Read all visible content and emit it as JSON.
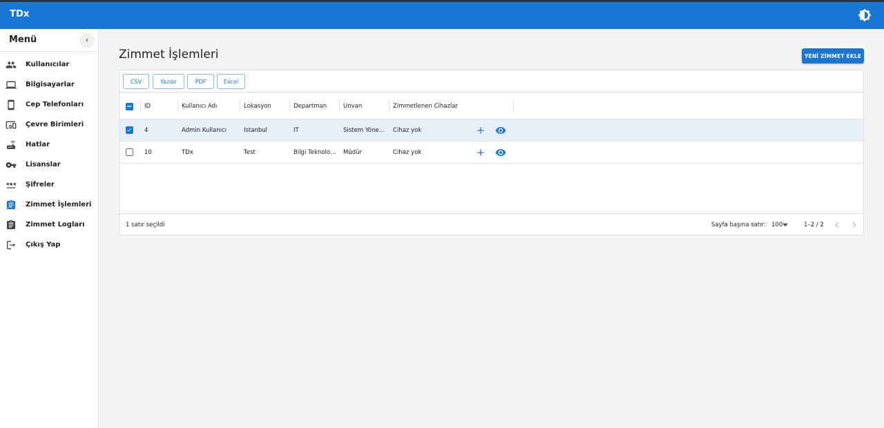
{
  "app": {
    "title": "TDx"
  },
  "sidebar": {
    "title": "Menü",
    "items": [
      {
        "label": "Kullanıcılar",
        "icon": "people-icon"
      },
      {
        "label": "Bilgisayarlar",
        "icon": "laptop-icon"
      },
      {
        "label": "Cep Telefonları",
        "icon": "smartphone-icon"
      },
      {
        "label": "Çevre Birimleri",
        "icon": "devices-icon"
      },
      {
        "label": "Hatlar",
        "icon": "router-icon"
      },
      {
        "label": "Lisanslar",
        "icon": "key-icon"
      },
      {
        "label": "Şifreler",
        "icon": "password-icon"
      },
      {
        "label": "Zimmet İşlemleri",
        "icon": "assignment-icon",
        "active": true
      },
      {
        "label": "Zimmet Logları",
        "icon": "clipboard-icon"
      },
      {
        "label": "Çıkış Yap",
        "icon": "logout-icon"
      }
    ]
  },
  "main": {
    "title": "Zimmet İşlemleri",
    "new_button": "YENİ ZİMMET EKLE",
    "export_buttons": [
      "CSV",
      "Yazdır",
      "PDF",
      "Excel"
    ]
  },
  "table": {
    "columns": [
      "ID",
      "Kullanıcı Adı",
      "Lokasyon",
      "Departman",
      "Unvan",
      "Zimmetlenen Cihazlar"
    ],
    "rows": [
      {
        "id": "4",
        "kullanici": "Admin Kullanıcı",
        "lokasyon": "İstanbul",
        "departman": "IT",
        "unvan": "Sistem Yöneticisi",
        "cihazlar": "Cihaz yok",
        "selected": true
      },
      {
        "id": "10",
        "kullanici": "TDx",
        "lokasyon": "Test",
        "departman": "Bilgi Teknolojileri",
        "unvan": "Müdür",
        "cihazlar": "Cihaz yok",
        "selected": false
      }
    ]
  },
  "footer": {
    "selection": "1 satır seçildi",
    "rows_per_page_label": "Sayfa başına satır:",
    "rows_per_page": "100",
    "range": "1–2 / 2"
  },
  "colors": {
    "primary": "#1976d2",
    "topbar": "#1976d2",
    "selected_row": "#e8eef7"
  }
}
